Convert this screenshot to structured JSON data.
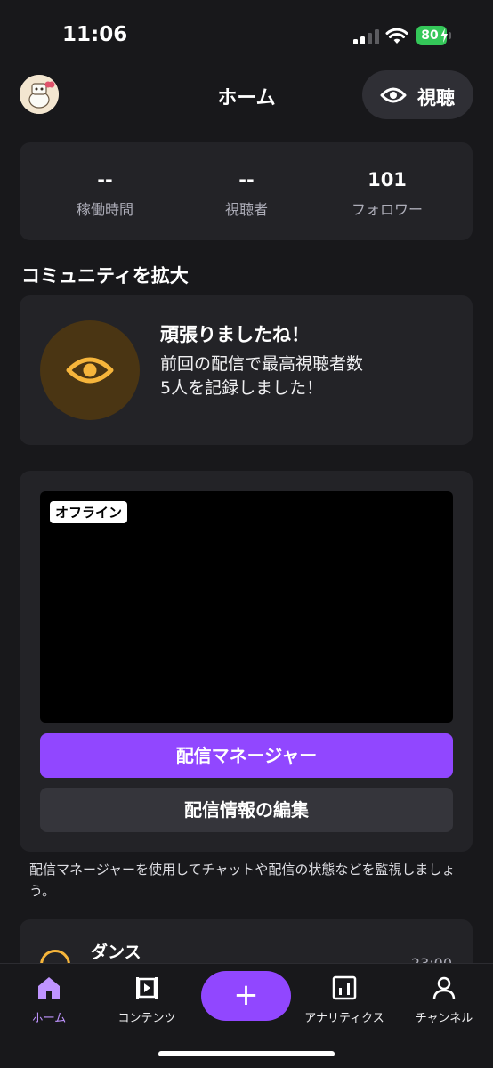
{
  "status_bar": {
    "time": "11:06",
    "battery": "80",
    "icons": [
      "signal-icon",
      "wifi-icon",
      "battery-icon"
    ]
  },
  "header": {
    "title": "ホーム",
    "watch_label": "視聴",
    "icons": [
      "avatar",
      "eye-icon"
    ]
  },
  "stats": [
    {
      "value": "--",
      "label": "稼働時間"
    },
    {
      "value": "--",
      "label": "視聴者"
    },
    {
      "value": "101",
      "label": "フォロワー"
    }
  ],
  "community": {
    "heading": "コミュニティを拡大",
    "title": "頑張りましたね！",
    "text": "前回の配信で最高視聴者数5人を記録しました！",
    "icon": "eye-icon"
  },
  "stream": {
    "offline_label": "オフライン",
    "manager_button": "配信マネージャー",
    "edit_button": "配信情報の編集",
    "helper_text": "配信マネージャーを使用してチャットや配信の状態などを監視しましょう。"
  },
  "category": {
    "name": "ダンス",
    "time": "23:00"
  },
  "tabs": [
    {
      "label": "ホーム",
      "icon": "home-icon",
      "active": true
    },
    {
      "label": "コンテンツ",
      "icon": "content-icon"
    },
    {
      "label": "+",
      "icon": "plus-icon"
    },
    {
      "label": "アナリティクス",
      "icon": "analytics-icon"
    },
    {
      "label": "チャンネル",
      "icon": "person-icon"
    }
  ],
  "colors": {
    "background": "#18181b",
    "card": "#232327",
    "accent": "#9147ff",
    "active_tab": "#bf94ff",
    "badge": "#4a3513",
    "badge_icon": "#f6b53b",
    "battery": "#34c759"
  }
}
